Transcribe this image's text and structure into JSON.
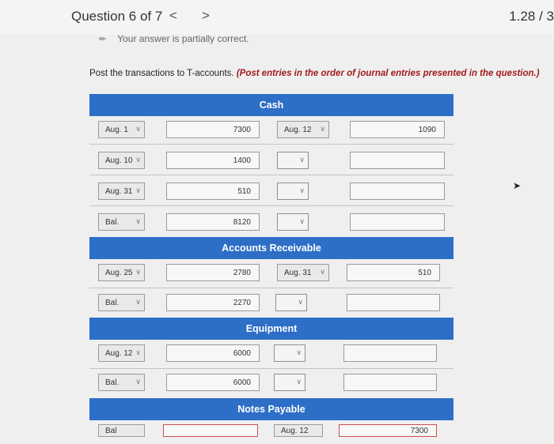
{
  "header": {
    "question_label": "Question 6 of 7",
    "prev": "<",
    "next": ">",
    "score": "1.28 / 3"
  },
  "status": "Your answer is partially correct.",
  "instructions": {
    "text": "Post the transactions to T-accounts.",
    "emphasis": "(Post entries in the order of journal entries presented in the question.)"
  },
  "accounts": {
    "cash": {
      "title": "Cash",
      "debit_rows": [
        {
          "date": "Aug. 1",
          "amount": "7300"
        },
        {
          "date": "Aug. 10",
          "amount": "1400"
        },
        {
          "date": "Aug. 31",
          "amount": "510"
        },
        {
          "date": "Bal.",
          "amount": "8120"
        }
      ],
      "credit_rows": [
        {
          "date": "Aug. 12",
          "amount": "1090"
        },
        {
          "date": "",
          "amount": ""
        },
        {
          "date": "",
          "amount": ""
        },
        {
          "date": "",
          "amount": ""
        }
      ]
    },
    "ar": {
      "title": "Accounts Receivable",
      "debit_rows": [
        {
          "date": "Aug. 25",
          "amount": "2780"
        },
        {
          "date": "Bal.",
          "amount": "2270"
        }
      ],
      "credit_rows": [
        {
          "date": "Aug. 31",
          "amount": "510"
        },
        {
          "date": "",
          "amount": ""
        }
      ]
    },
    "equipment": {
      "title": "Equipment",
      "debit_rows": [
        {
          "date": "Aug. 12",
          "amount": "6000"
        },
        {
          "date": "Bal.",
          "amount": "6000"
        }
      ],
      "credit_rows": [
        {
          "date": "",
          "amount": ""
        },
        {
          "date": "",
          "amount": ""
        }
      ]
    },
    "notes": {
      "title": "Notes Payable",
      "debit_rows": [
        {
          "date": "Bal",
          "amount": ""
        }
      ],
      "credit_rows": [
        {
          "date": "Aug. 12",
          "amount": "7300"
        }
      ]
    }
  },
  "icons": {
    "pencil": "pencil-icon",
    "chevron": "chevron-down-icon",
    "cursor": "mouse-cursor-icon"
  },
  "colors": {
    "header_blue": "#2d6ec6",
    "emphasis_red": "#a21b1b",
    "error_border": "#c65252"
  }
}
